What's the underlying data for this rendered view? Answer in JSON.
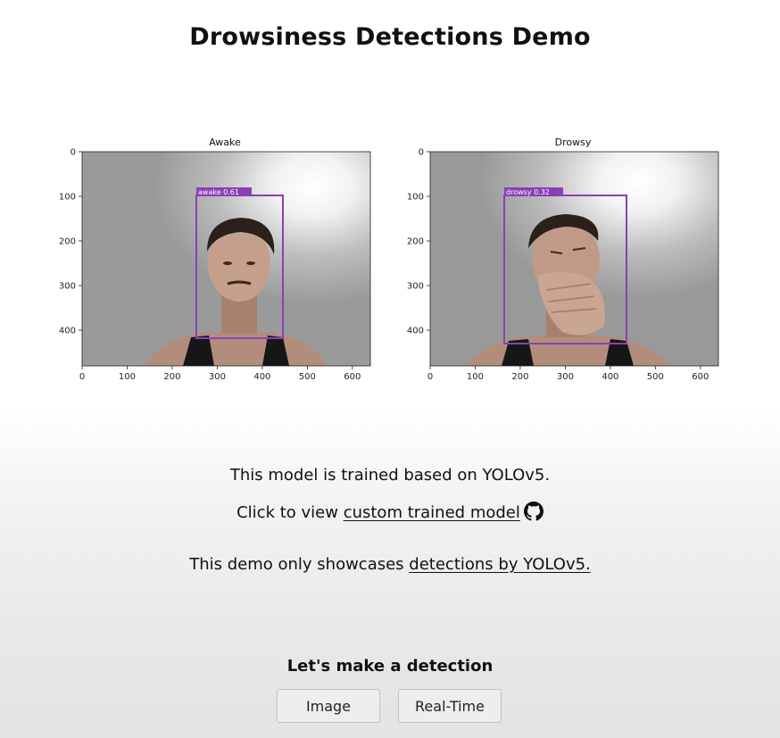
{
  "page": {
    "title": "Drowsiness Detections Demo"
  },
  "plots": [
    {
      "title": "Awake",
      "label": "awake 0.61",
      "box_color": "#8b3fb7",
      "x_ticks": [
        "0",
        "100",
        "200",
        "300",
        "400",
        "500",
        "600"
      ],
      "y_ticks": [
        "0",
        "100",
        "200",
        "300",
        "400"
      ],
      "box": {
        "x1": 255,
        "y1": 98,
        "x2": 448,
        "y2": 418
      }
    },
    {
      "title": "Drowsy",
      "label": "drowsy 0.32",
      "box_color": "#8b3fb7",
      "x_ticks": [
        "0",
        "100",
        "200",
        "300",
        "400",
        "500",
        "600"
      ],
      "y_ticks": [
        "0",
        "100",
        "200",
        "300",
        "400"
      ],
      "box": {
        "x1": 165,
        "y1": 98,
        "x2": 435,
        "y2": 430
      }
    }
  ],
  "info": {
    "line1": "This model is trained based on YOLOv5.",
    "line2_prefix": "Click to view ",
    "line2_link": "custom trained model",
    "line3_prefix": "This demo only showcases ",
    "line3_link": "detections by YOLOv5."
  },
  "cta": {
    "heading": "Let's make a detection",
    "image_button": "Image",
    "realtime_button": "Real-Time"
  },
  "icons": {
    "github": "github-icon"
  }
}
